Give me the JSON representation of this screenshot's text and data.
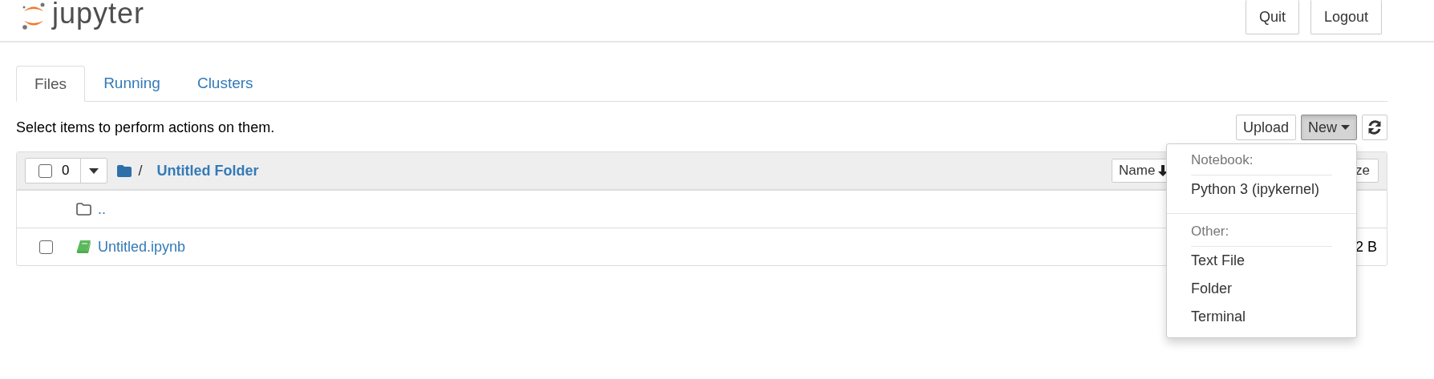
{
  "header": {
    "logo_text": "jupyter",
    "buttons": [
      "Quit",
      "Logout"
    ]
  },
  "tabs": [
    {
      "label": "Files",
      "selected": true
    },
    {
      "label": "Running",
      "selected": false
    },
    {
      "label": "Clusters",
      "selected": false
    }
  ],
  "hint": "Select items to perform actions on them.",
  "toolbar": {
    "upload": "Upload",
    "new": {
      "label": "New",
      "active": true
    }
  },
  "listing": {
    "select_all": {
      "checked": false,
      "count": "0"
    },
    "breadcrumb": {
      "separator": "/",
      "folder": "Untitled Folder"
    },
    "sort_button": "Name",
    "column_3": "ze",
    "rows": [
      {
        "kind": "parent",
        "name": ".."
      },
      {
        "kind": "notebook",
        "name": "Untitled.ipynb",
        "checked": false,
        "size": "2 B"
      }
    ]
  },
  "menu": {
    "sections": [
      {
        "heading": "Notebook:",
        "items": [
          "Python 3 (ipykernel)"
        ]
      },
      {
        "heading": "Other:",
        "items": [
          "Text File",
          "Folder",
          "Terminal"
        ]
      }
    ]
  }
}
